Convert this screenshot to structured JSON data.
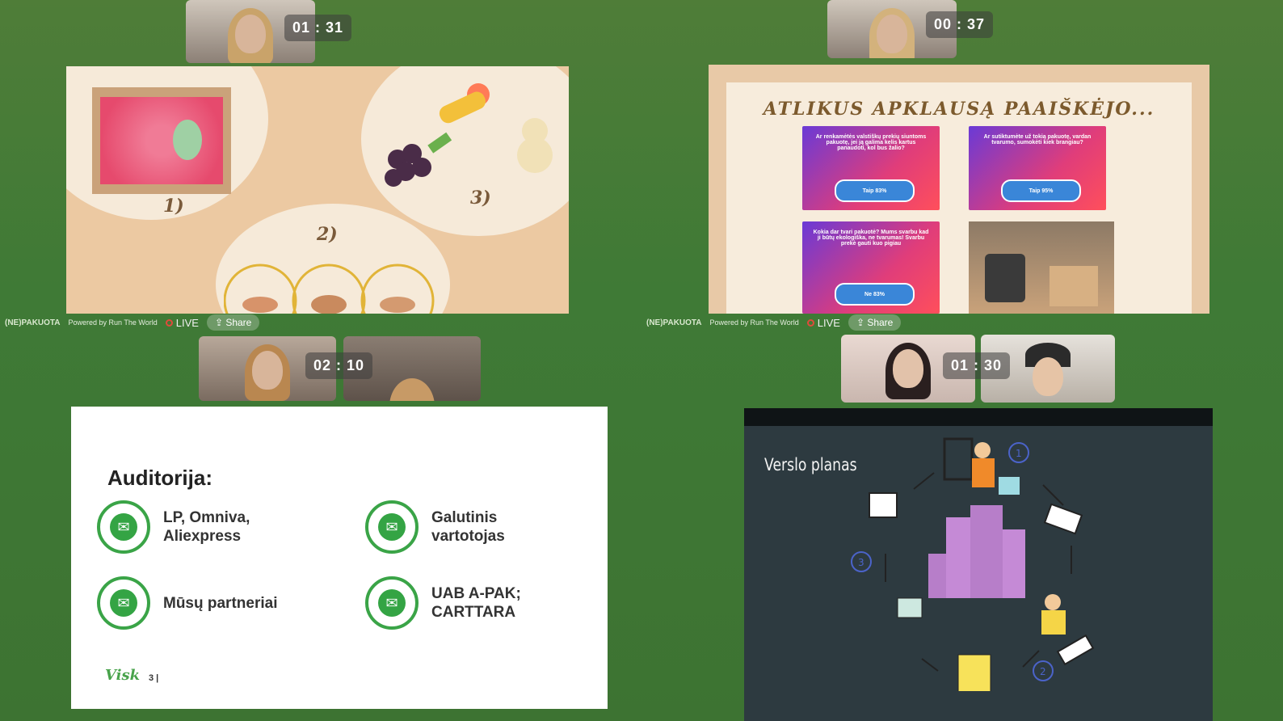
{
  "panels": {
    "top_left": {
      "timer": "01 : 31",
      "slide": {
        "labels": [
          "1)",
          "2)",
          "3)"
        ]
      }
    },
    "top_right": {
      "timer": "00 : 37",
      "slide": {
        "title": "ATLIKUS APKLAUSĄ PAAIŠKĖJO...",
        "polls": [
          {
            "question": "Ar renkamėtės valstiškų prekių siuntoms pakuotę, jei ją galima kelis kartus panaudoti, kol bus žalio?",
            "answer": "Taip 83%"
          },
          {
            "question": "Ar sutiktumėte už tokią pakuotę, vardan tvarumo, sumokėti kiek brangiau?",
            "answer": "Taip 95%"
          },
          {
            "question": "Kokia dar tvari pakuotė? Mums svarbu kad ji būtų ekologiška, ne tvarumas! Svarbu prekė gauti kuo pigiau",
            "answer": "Ne 83%"
          }
        ]
      }
    },
    "bottom_left": {
      "header": {
        "logo": "(NE)PAKUOTA",
        "subtitle": "Powered by Run The World",
        "live": "LIVE",
        "share": "Share"
      },
      "timer": "02 : 10",
      "slide": {
        "title": "Auditorija:",
        "items": [
          "LP, Omniva, Aliexpress",
          "Galutinis vartotojas",
          "Mūsų partneriai",
          "UAB A-PAK; CARTTARA"
        ],
        "logo": "Visk",
        "page": "3 |"
      }
    },
    "bottom_right": {
      "header": {
        "logo": "(NE)PAKUOTA",
        "subtitle": "Powered by Run The World",
        "live": "LIVE",
        "share": "Share"
      },
      "timer": "01 : 30",
      "slide": {
        "title": "Verslo planas",
        "steps": [
          "1",
          "2",
          "3"
        ]
      }
    }
  },
  "colors": {
    "background": "#44792f",
    "accent_green": "#3aa447",
    "poll_gradient_start": "#6a3ad6",
    "poll_gradient_end": "#ff4f5b",
    "live_dot": "#e04b3b"
  }
}
